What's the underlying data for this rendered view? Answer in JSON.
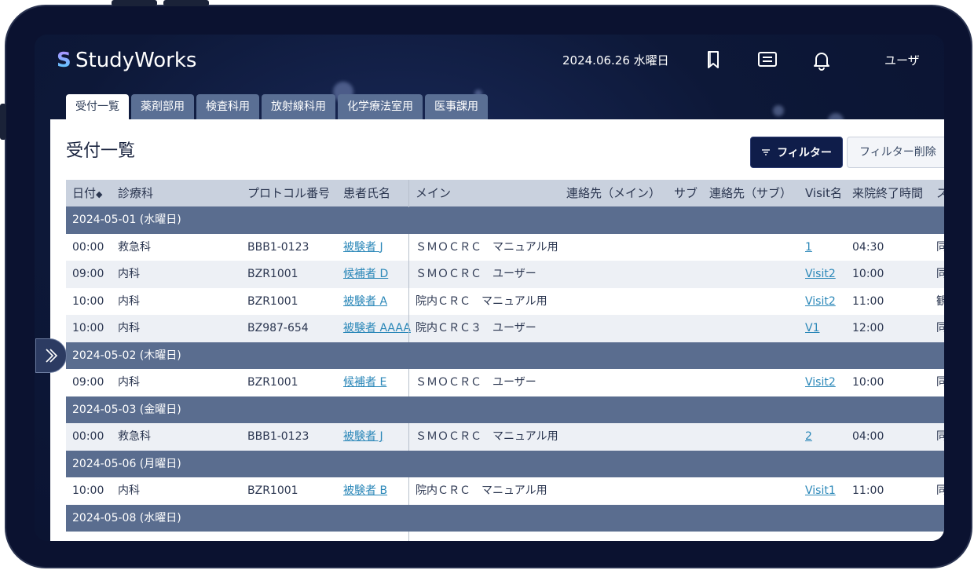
{
  "app": {
    "brand": "StudyWorks",
    "brand_mark": "S"
  },
  "header": {
    "date": "2024.06.26 水曜日",
    "user": "ユーザ"
  },
  "icons": [
    "bookmark-icon",
    "message-icon",
    "bell-icon",
    "filter-icon",
    "double-chevron-right-icon"
  ],
  "tabs": [
    {
      "label": "受付一覧",
      "active": true
    },
    {
      "label": "薬剤部用"
    },
    {
      "label": "検査科用"
    },
    {
      "label": "放射線科用"
    },
    {
      "label": "化学療法室用"
    },
    {
      "label": "医事課用"
    }
  ],
  "page": {
    "title": "受付一覧",
    "filter_label": "フィルター",
    "filter_clear_label": "フィルター削除"
  },
  "table": {
    "headers": [
      "日付",
      "診療科",
      "プロトコル番号",
      "患者氏名",
      "メイン",
      "連絡先（メイン）",
      "サブ",
      "連絡先（サブ）",
      "Visit名",
      "来院終了時間",
      "ス"
    ],
    "sort_indicator": "◆",
    "groups": [
      {
        "date": "2024-05-01 (水曜日)",
        "rows": [
          {
            "time": "00:00",
            "dept": "救急科",
            "protocol": "BBB1-0123",
            "patient": "被験者 J",
            "main": "ＳＭＯＣＲＣ　マニュアル用",
            "visit": "1",
            "end": "04:30",
            "status": "同"
          },
          {
            "time": "09:00",
            "dept": "内科",
            "protocol": "BZR1001",
            "patient": "候補者 D",
            "main": "ＳＭＯＣＲＣ　ユーザー",
            "visit": "Visit2",
            "end": "10:00",
            "status": "同"
          },
          {
            "time": "10:00",
            "dept": "内科",
            "protocol": "BZR1001",
            "patient": "被験者 A",
            "main": "院内ＣＲＣ　マニュアル用",
            "visit": "Visit2",
            "end": "11:00",
            "status": "観"
          },
          {
            "time": "10:00",
            "dept": "内科",
            "protocol": "BZ987-654",
            "patient": "被験者 AAAA",
            "main": "院内ＣＲＣ３　ユーザー",
            "visit": "V1",
            "end": "12:00",
            "status": "同"
          }
        ]
      },
      {
        "date": "2024-05-02 (木曜日)",
        "rows": [
          {
            "time": "09:00",
            "dept": "内科",
            "protocol": "BZR1001",
            "patient": "候補者 E",
            "main": "ＳＭＯＣＲＣ　ユーザー",
            "visit": "Visit2",
            "end": "10:00",
            "status": "同"
          }
        ]
      },
      {
        "date": "2024-05-03 (金曜日)",
        "rows": [
          {
            "time": "00:00",
            "dept": "救急科",
            "protocol": "BBB1-0123",
            "patient": "被験者 J",
            "main": "ＳＭＯＣＲＣ　マニュアル用",
            "visit": "2",
            "end": "04:00",
            "status": "同"
          }
        ]
      },
      {
        "date": "2024-05-06 (月曜日)",
        "rows": [
          {
            "time": "10:00",
            "dept": "内科",
            "protocol": "BZR1001",
            "patient": "被験者 B",
            "main": "院内ＣＲＣ　マニュアル用",
            "visit": "Visit1",
            "end": "11:00",
            "status": "同"
          }
        ]
      },
      {
        "date": "2024-05-08 (水曜日)",
        "rows": []
      }
    ]
  }
}
